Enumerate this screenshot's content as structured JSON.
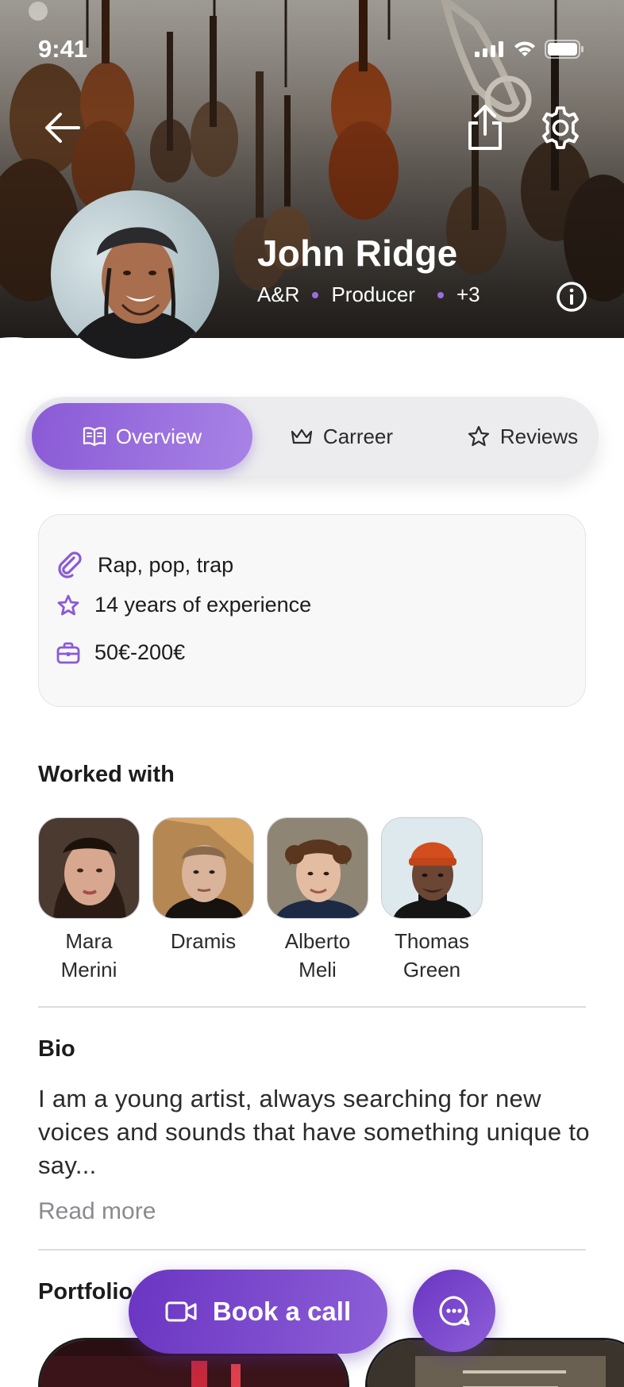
{
  "status_bar": {
    "time": "9:41"
  },
  "profile": {
    "name": "John Ridge",
    "roles": [
      "A&R",
      "Producer"
    ],
    "more_roles": "+3"
  },
  "tabs": [
    {
      "label": "Overview",
      "icon": "book-icon",
      "active": true
    },
    {
      "label": "Carreer",
      "icon": "crown-icon",
      "active": false
    },
    {
      "label": "Reviews",
      "icon": "star-icon",
      "active": false
    }
  ],
  "info": {
    "genres": "Rap, pop, trap",
    "experience": "14 years of experience",
    "price": "50€-200€"
  },
  "worked_with": {
    "title": "Worked with",
    "people": [
      {
        "line1": "Mara",
        "line2": "Merini"
      },
      {
        "line1": "Dramis",
        "line2": ""
      },
      {
        "line1": "Alberto",
        "line2": "Meli"
      },
      {
        "line1": "Thomas",
        "line2": "Green"
      }
    ]
  },
  "bio": {
    "title": "Bio",
    "text": "I am a young artist, always searching for new voices and sounds that have something unique to say...",
    "read_more": "Read more"
  },
  "portfolio": {
    "title": "Portfolio"
  },
  "actions": {
    "book_label": "Book a call"
  },
  "colors": {
    "accent": "#8a5ad6",
    "accent_dark": "#6a35c2"
  }
}
